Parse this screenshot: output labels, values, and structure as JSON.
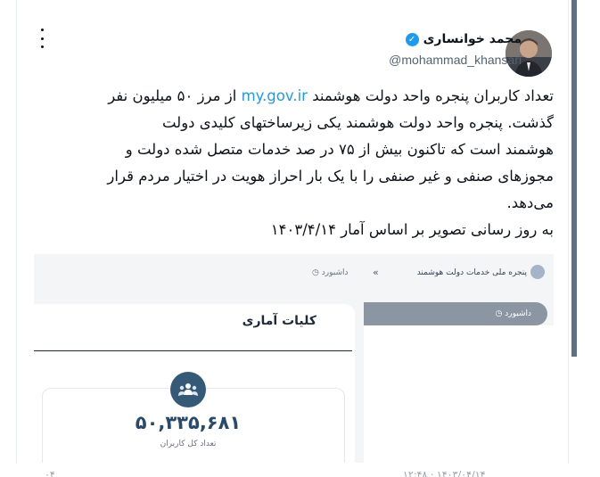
{
  "author": {
    "display_name": "محمد خوانساری",
    "handle": "@mohammad_khansari",
    "verified_icon": "verified-badge-icon"
  },
  "tweet": {
    "line1_before_link": "تعداد کاربران پنجره واحد دولت هوشمند",
    "link_text": "my.gov.ir",
    "line1_after_link": "از مرز ۵۰ میلیون نفر",
    "line2": "گذشت. پنجره واحد دولت هوشمند یکی زیرساختهای کلیدی  دولت",
    "line3": "هوشمند است که تاکنون بیش از ۷۵ در صد خدمات متصل شده دولت و",
    "line4": "مجوزهای صنفی و غیر صنفی را با یک بار احراز هویت در اختیار مردم قرار",
    "line5": "می‌دهد.",
    "line6": "به روز رسانی تصویر بر اساس آمار ۱۴۰۳/۴/۱۴"
  },
  "media": {
    "portal_title": "پنجره ملی خدمات دولت هوشمند",
    "collapse_glyph": "«",
    "breadcrumb": "داشبورد",
    "sidebar_item": "داشبورد",
    "stats_title": "کلیات آماری",
    "users_count": "۵۰,۳۳۵,۶۸۱",
    "users_label": "تعداد کل کاربران"
  },
  "footer": {
    "left_text": "۰۴",
    "right_text": "۱۲:۴۸ · ۱۴۰۳/۰۴/۱۴"
  },
  "colors": {
    "link": "#1d9bf0",
    "verified": "#1d9bf0",
    "badge": "#345a78",
    "count": "#2a4a6a"
  }
}
